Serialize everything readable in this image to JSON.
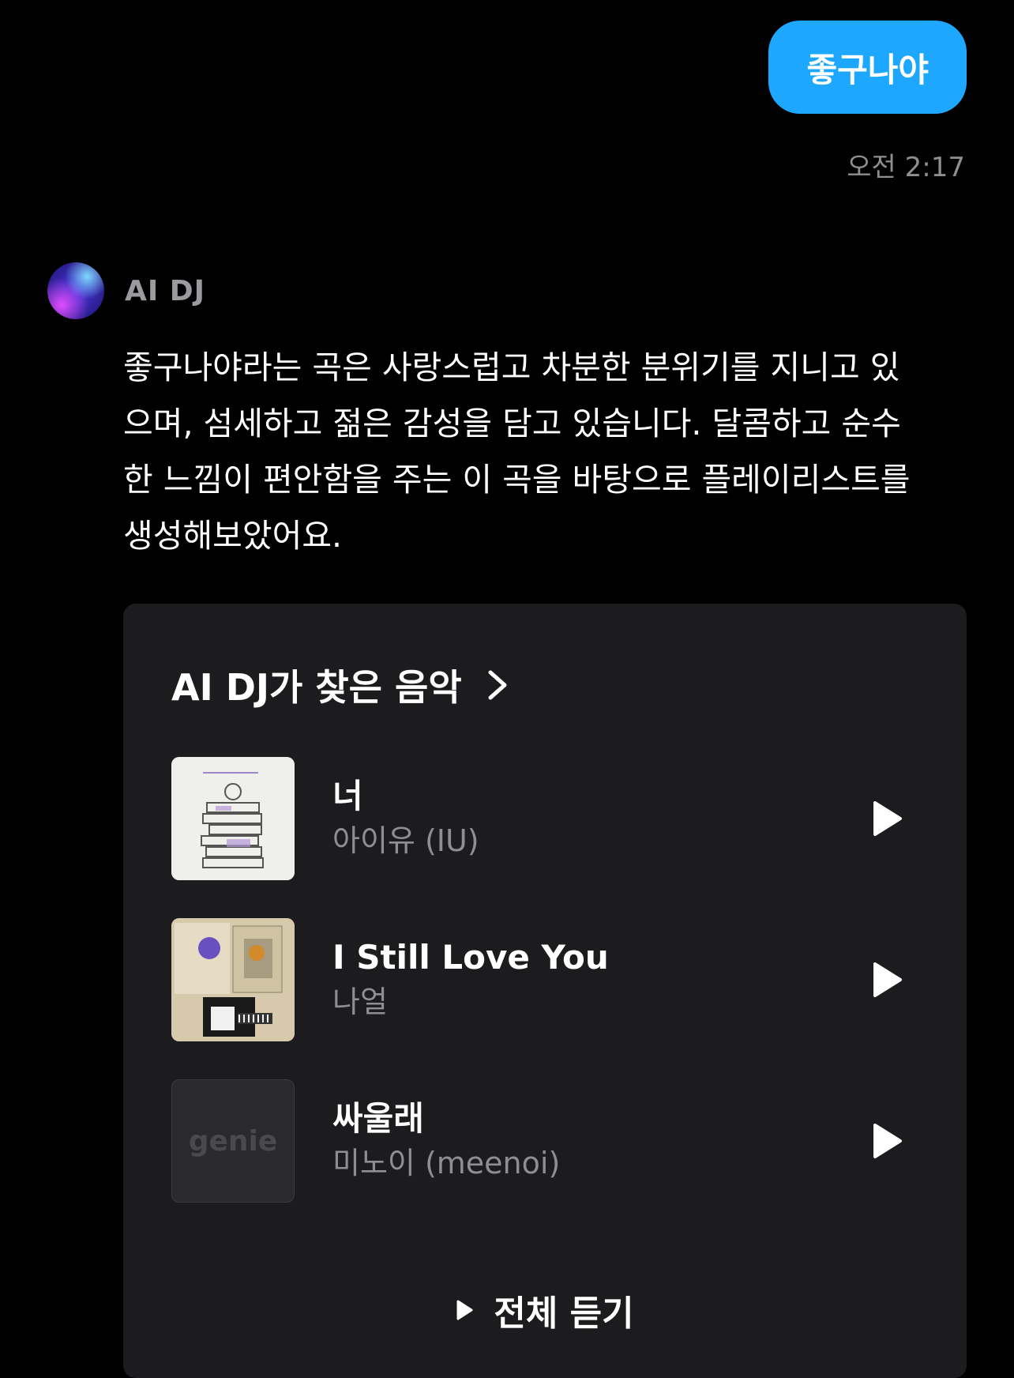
{
  "colors": {
    "background": "#000000",
    "user_bubble": "#1ea7ff",
    "card_background": "#1c1c1e",
    "secondary_text": "#8e8e93"
  },
  "user_message": {
    "text": "좋구나야",
    "time": "오전 2:17"
  },
  "bot": {
    "name": "AI DJ",
    "message": "좋구나야라는 곡은 사랑스럽고 차분한 분위기를 지니고 있으며, 섬세하고 젊은 감성을 담고 있습니다. 달콤하고 순수한 느낌이 편안함을 주는 이 곡을 바탕으로 플레이리스트를 생성해보았어요."
  },
  "playlist": {
    "title": "AI DJ가 찾은 음악",
    "tracks": [
      {
        "title": "너",
        "artist": "아이유 (IU)",
        "thumb": "sketch-books-cover"
      },
      {
        "title": "I Still Love You",
        "artist": "나얼",
        "thumb": "collage-cover"
      },
      {
        "title": "싸울래",
        "artist": "미노이 (meenoi)",
        "thumb": "genie-placeholder",
        "thumb_text": "genie"
      }
    ],
    "play_all_label": "전체 듣기"
  }
}
